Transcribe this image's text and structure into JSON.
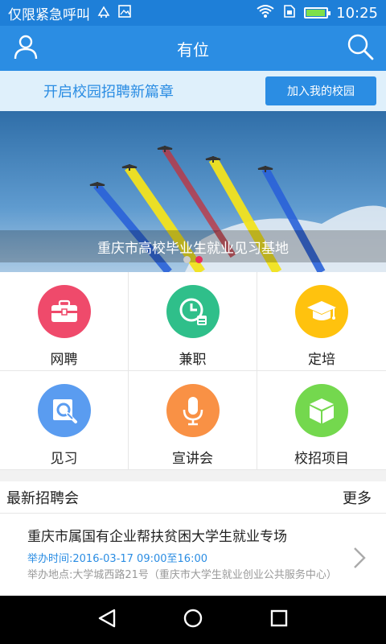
{
  "status_bar": {
    "carrier_text": "仅限紧急呼叫",
    "time": "10:25",
    "battery_level": 0.95,
    "icons": [
      "usb-icon",
      "image-icon",
      "wifi-icon",
      "sim-icon",
      "battery-icon"
    ]
  },
  "app_bar": {
    "title": "有位",
    "left_icon": "user-icon",
    "right_icon": "search-icon"
  },
  "promo": {
    "text": "开启校园招聘新篇章",
    "button_label": "加入我的校园"
  },
  "banner": {
    "caption": "重庆市高校毕业生就业见习基地",
    "slide_count": 2,
    "active_slide": 2
  },
  "categories": [
    {
      "label": "网聘",
      "icon": "briefcase-icon",
      "color": "#ef4a6b"
    },
    {
      "label": "兼职",
      "icon": "clock-icon",
      "color": "#2fbf8a"
    },
    {
      "label": "定培",
      "icon": "graduation-cap-icon",
      "color": "#ffc20e"
    },
    {
      "label": "见习",
      "icon": "document-search-icon",
      "color": "#5a9cf0"
    },
    {
      "label": "宣讲会",
      "icon": "microphone-icon",
      "color": "#f99145"
    },
    {
      "label": "校招项目",
      "icon": "box-icon",
      "color": "#74d84e"
    }
  ],
  "latest_fairs": {
    "title": "最新招聘会",
    "more_label": "更多",
    "items": [
      {
        "title": "重庆市属国有企业帮扶贫困大学生就业专场",
        "time": "举办时间:2016-03-17 09:00至16:00",
        "place": "举办地点:大学城西路21号（重庆市大学生就业创业公共服务中心）"
      }
    ]
  },
  "colors": {
    "primary": "#2b8de3",
    "status_bar": "#1e7fd8",
    "promo_bg": "#dff0fb",
    "active_dot": "#e8305a"
  }
}
